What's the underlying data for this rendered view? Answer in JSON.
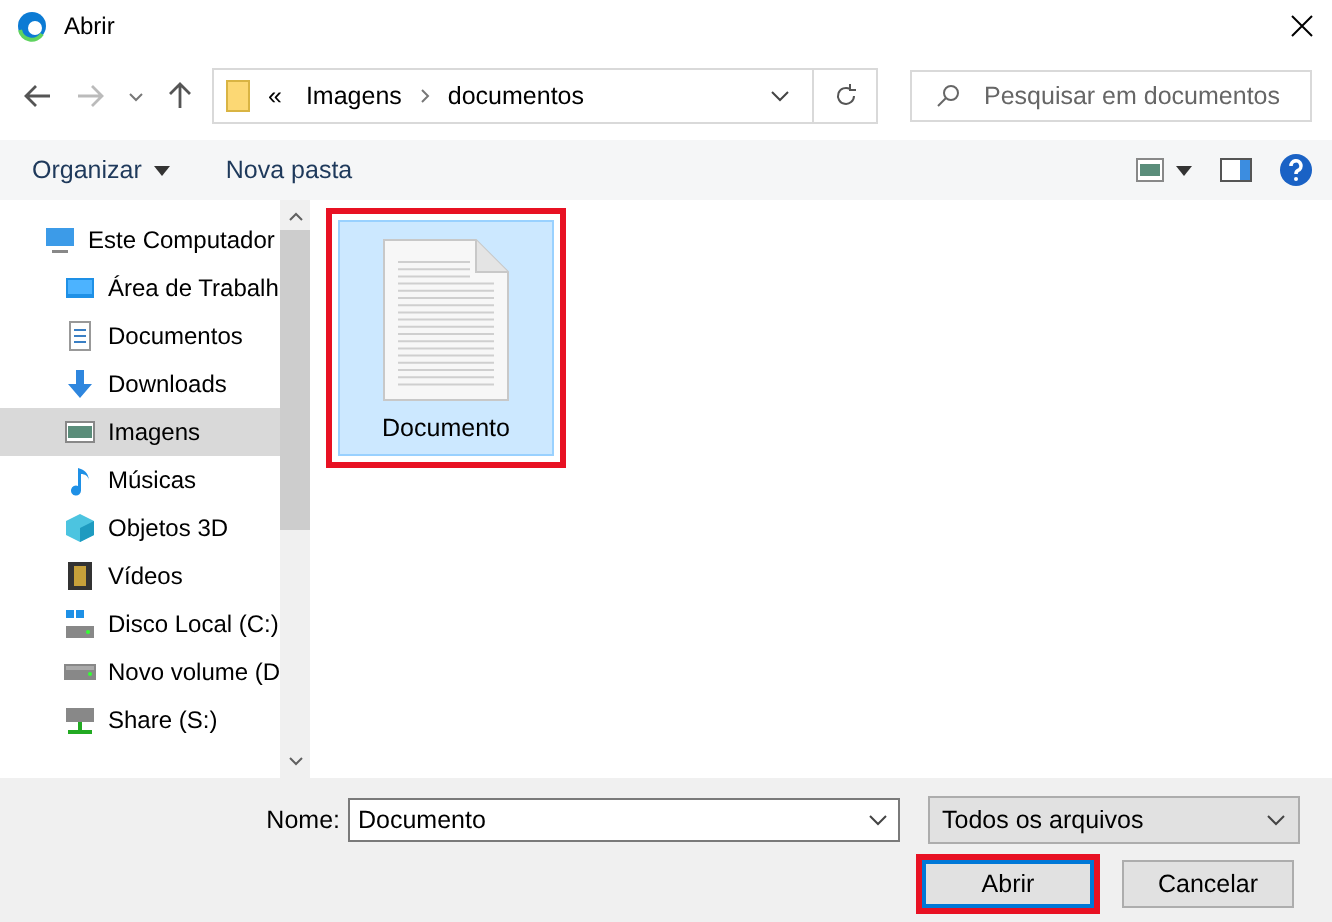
{
  "window": {
    "title": "Abrir"
  },
  "address_bar": {
    "overflow": "«",
    "path": [
      "Imagens",
      "documentos"
    ]
  },
  "search": {
    "placeholder": "Pesquisar em documentos"
  },
  "toolbar": {
    "organize": "Organizar",
    "new_folder": "Nova pasta"
  },
  "sidebar": {
    "items": [
      {
        "label": "Este Computador",
        "selected": false,
        "children": [
          {
            "label": "Área de Trabalh",
            "selected": false
          },
          {
            "label": "Documentos",
            "selected": false
          },
          {
            "label": "Downloads",
            "selected": false
          },
          {
            "label": "Imagens",
            "selected": true
          },
          {
            "label": "Músicas",
            "selected": false
          },
          {
            "label": "Objetos 3D",
            "selected": false
          },
          {
            "label": "Vídeos",
            "selected": false
          },
          {
            "label": "Disco Local (C:)",
            "selected": false
          },
          {
            "label": "Novo volume (D",
            "selected": false
          },
          {
            "label": "Share (S:)",
            "selected": false
          }
        ]
      }
    ]
  },
  "files": [
    {
      "name": "Documento",
      "selected": true,
      "highlighted": true
    }
  ],
  "footer": {
    "name_label": "Nome:",
    "name_value": "Documento",
    "file_type": "Todos os arquivos",
    "buttons": [
      {
        "label": "Abrir",
        "primary": true,
        "highlighted": true
      },
      {
        "label": "Cancelar",
        "primary": false,
        "highlighted": false
      }
    ]
  }
}
